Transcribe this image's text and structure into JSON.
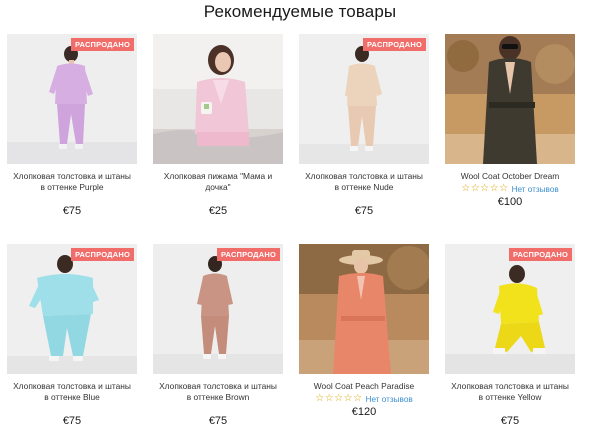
{
  "section_title": "Рекомендуемые товары",
  "badge_colors": {
    "sold_out_bg": "#f16d6a"
  },
  "products": [
    {
      "name": "Хлопковая толстовка и штаны в оттенке Purple",
      "price": "€75",
      "badge": "РАСПРОДАНО",
      "image": "model-lilac-tracksuit"
    },
    {
      "name": "Хлопковая пижама \"Мама и дочка\"",
      "price": "€25",
      "badge": "",
      "image": "model-pink-pajamas"
    },
    {
      "name": "Хлопковая толстовка и штаны в оттенке Nude",
      "price": "€75",
      "badge": "РАСПРОДАНО",
      "image": "model-nude-tracksuit"
    },
    {
      "name": "Wool Coat October Dream",
      "price": "€100",
      "badge": "",
      "rating": "☆☆☆☆☆",
      "reviews": "Нет отзывов",
      "image": "model-dark-coat"
    },
    {
      "name": "Хлопковая толстовка и штаны в оттенке Blue",
      "price": "€75",
      "badge": "РАСПРОДАНО",
      "image": "model-blue-tracksuit"
    },
    {
      "name": "Хлопковая толстовка и штаны в оттенке Brown",
      "price": "€75",
      "badge": "РАСПРОДАНО",
      "image": "model-brown-tracksuit"
    },
    {
      "name": "Wool Coat Peach Paradise",
      "price": "€120",
      "badge": "",
      "rating": "☆☆☆☆☆",
      "reviews": "Нет отзывов",
      "image": "model-peach-coat"
    },
    {
      "name": "Хлопковая толстовка и штаны в оттенке Yellow",
      "price": "€75",
      "badge": "РАСПРОДАНО",
      "image": "model-yellow-tracksuit"
    }
  ]
}
